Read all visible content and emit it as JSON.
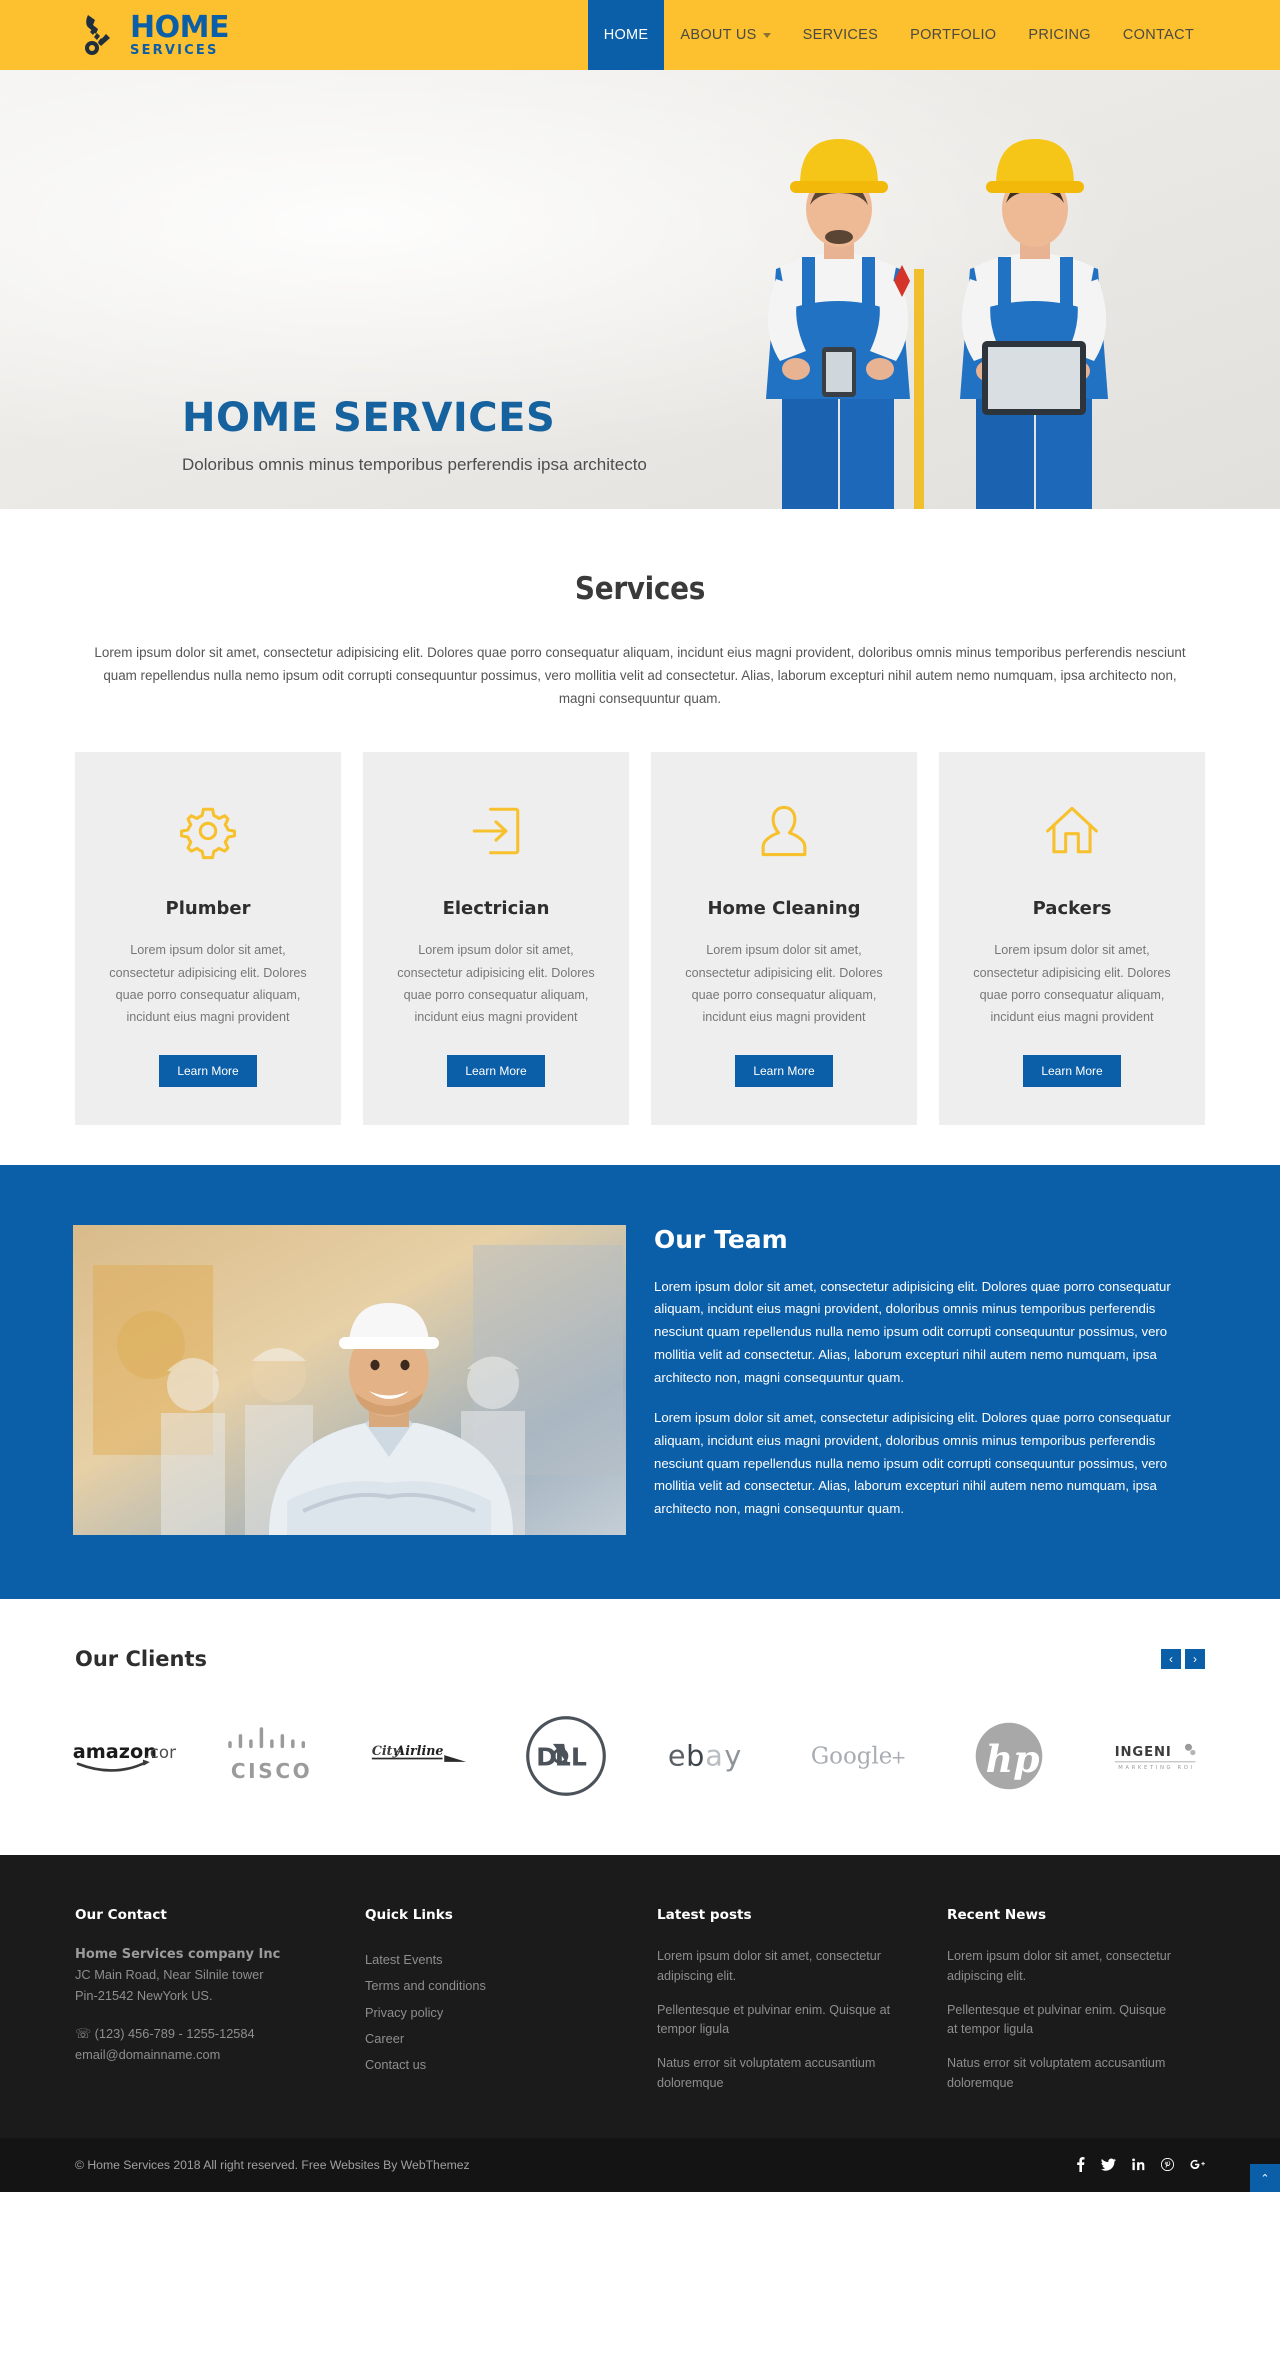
{
  "brand": {
    "logo_main": "HOME",
    "logo_sub": "SERVICES",
    "logo_icon": "wrench-gear-icon",
    "accent_yellow": "#fdc02f",
    "accent_blue": "#0b5ea8"
  },
  "nav": {
    "items": [
      {
        "label": "HOME",
        "active": true,
        "dropdown": false
      },
      {
        "label": "ABOUT US",
        "active": false,
        "dropdown": true
      },
      {
        "label": "SERVICES",
        "active": false,
        "dropdown": false
      },
      {
        "label": "PORTFOLIO",
        "active": false,
        "dropdown": false
      },
      {
        "label": "PRICING",
        "active": false,
        "dropdown": false
      },
      {
        "label": "CONTACT",
        "active": false,
        "dropdown": false
      }
    ]
  },
  "hero": {
    "title": "HOME SERVICES",
    "subtitle": "Doloribus omnis minus temporibus perferendis ipsa architecto"
  },
  "services": {
    "title": "Services",
    "intro": "Lorem ipsum dolor sit amet, consectetur adipisicing elit. Dolores quae porro consequatur aliquam, incidunt eius magni provident, doloribus omnis minus temporibus perferendis nesciunt quam repellendus nulla nemo ipsum odit corrupti consequuntur possimus, vero mollitia velit ad consectetur. Alias, laborum excepturi nihil autem nemo numquam, ipsa architecto non, magni consequuntur quam.",
    "cards": [
      {
        "icon": "gear-icon",
        "title": "Plumber",
        "text": "Lorem ipsum dolor sit amet, consectetur adipisicing elit. Dolores quae porro consequatur aliquam, incidunt eius magni provident",
        "button": "Learn More"
      },
      {
        "icon": "login-arrow-icon",
        "title": "Electrician",
        "text": "Lorem ipsum dolor sit amet, consectetur adipisicing elit. Dolores quae porro consequatur aliquam, incidunt eius magni provident",
        "button": "Learn More"
      },
      {
        "icon": "user-icon",
        "title": "Home Cleaning",
        "text": "Lorem ipsum dolor sit amet, consectetur adipisicing elit. Dolores quae porro consequatur aliquam, incidunt eius magni provident",
        "button": "Learn More"
      },
      {
        "icon": "house-icon",
        "title": "Packers",
        "text": "Lorem ipsum dolor sit amet, consectetur adipisicing elit. Dolores quae porro consequatur aliquam, incidunt eius magni provident",
        "button": "Learn More"
      }
    ]
  },
  "team": {
    "title": "Our Team",
    "paragraph1": "Lorem ipsum dolor sit amet, consectetur adipisicing elit. Dolores quae porro consequatur aliquam, incidunt eius magni provident, doloribus omnis minus temporibus perferendis nesciunt quam repellendus nulla nemo ipsum odit corrupti consequuntur possimus, vero mollitia velit ad consectetur. Alias, laborum excepturi nihil autem nemo numquam, ipsa architecto non, magni consequuntur quam.",
    "paragraph2": "Lorem ipsum dolor sit amet, consectetur adipisicing elit. Dolores quae porro consequatur aliquam, incidunt eius magni provident, doloribus omnis minus temporibus perferendis nesciunt quam repellendus nulla nemo ipsum odit corrupti consequuntur possimus, vero mollitia velit ad consectetur. Alias, laborum excepturi nihil autem nemo numquam, ipsa architecto non, magni consequuntur quam.",
    "photo_alt": "team-engineer-photo"
  },
  "clients": {
    "title": "Our Clients",
    "prev_label": "‹",
    "next_label": "›",
    "logos": [
      {
        "name": "amazon.com",
        "id": "amazon-logo"
      },
      {
        "name": "CISCO",
        "id": "cisco-logo"
      },
      {
        "name": "City Airline",
        "id": "cityairline-logo"
      },
      {
        "name": "DELL",
        "id": "dell-logo"
      },
      {
        "name": "ebay",
        "id": "ebay-logo"
      },
      {
        "name": "Google+",
        "id": "googleplus-logo"
      },
      {
        "name": "hp",
        "id": "hp-logo"
      },
      {
        "name": "INGENI",
        "id": "ingeni-logo"
      }
    ]
  },
  "footer": {
    "contact": {
      "title": "Our Contact",
      "company": "Home Services company Inc",
      "address_line1": "JC Main Road, Near Silnile tower",
      "address_line2": "Pin-21542 NewYork US.",
      "phone": "(123) 456-789 - 1255-12584",
      "phone_icon": "phone-icon",
      "email": "email@domainname.com"
    },
    "quick_links": {
      "title": "Quick Links",
      "items": [
        "Latest Events",
        "Terms and conditions",
        "Privacy policy",
        "Career",
        "Contact us"
      ]
    },
    "latest_posts": {
      "title": "Latest posts",
      "items": [
        "Lorem ipsum dolor sit amet, consectetur adipiscing elit.",
        "Pellentesque et pulvinar enim. Quisque at tempor ligula",
        "Natus error sit voluptatem accusantium doloremque"
      ]
    },
    "recent_news": {
      "title": "Recent News",
      "items": [
        "Lorem ipsum dolor sit amet, consectetur adipiscing elit.",
        "Pellentesque et pulvinar enim. Quisque at tempor ligula",
        "Natus error sit voluptatem accusantium doloremque"
      ]
    },
    "copyright": "© Home Services 2018 All right reserved. Free Websites By WebThemez",
    "socials": [
      {
        "name": "facebook-icon",
        "glyph": "f"
      },
      {
        "name": "twitter-icon",
        "glyph": "ᵛ"
      },
      {
        "name": "linkedin-icon",
        "glyph": "in"
      },
      {
        "name": "pinterest-icon",
        "glyph": "Ⓟ"
      },
      {
        "name": "googleplus-icon",
        "glyph": "g+"
      }
    ],
    "back_to_top": "⌃"
  }
}
